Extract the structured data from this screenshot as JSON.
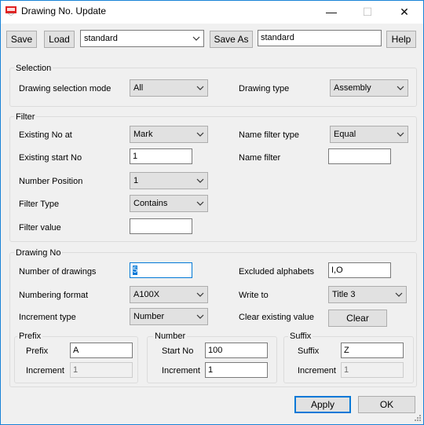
{
  "window": {
    "title": "Drawing No. Update",
    "accent_color": "#0078d7"
  },
  "title_buttons": {
    "minimize": "—",
    "maximize": "☐",
    "close": "✕"
  },
  "toolbar": {
    "save_label": "Save",
    "load_label": "Load",
    "load_value": "standard",
    "save_as_label": "Save As",
    "save_as_value": "standard",
    "help_label": "Help"
  },
  "selection": {
    "title": "Selection",
    "mode_label": "Drawing selection mode",
    "mode_value": "All",
    "type_label": "Drawing type",
    "type_value": "Assembly"
  },
  "filter": {
    "title": "Filter",
    "existing_no_at_label": "Existing No at",
    "existing_no_at_value": "Mark",
    "name_filter_type_label": "Name filter type",
    "name_filter_type_value": "Equal",
    "existing_start_label": "Existing start No",
    "existing_start_value": "1",
    "name_filter_label": "Name filter",
    "name_filter_value": "",
    "number_position_label": "Number Position",
    "number_position_value": "1",
    "filter_type_label": "Filter Type",
    "filter_type_value": "Contains",
    "filter_value_label": "Filter value",
    "filter_value_value": ""
  },
  "drawing_no": {
    "title": "Drawing No",
    "num_drawings_label": "Number of drawings",
    "num_drawings_value": "5",
    "excluded_label": "Excluded alphabets",
    "excluded_value": "I,O",
    "format_label": "Numbering format",
    "format_value": "A100X",
    "write_to_label": "Write to",
    "write_to_value": "Title 3",
    "increment_type_label": "Increment type",
    "increment_type_value": "Number",
    "clear_existing_label": "Clear existing value",
    "clear_button": "Clear",
    "prefix": {
      "title": "Prefix",
      "prefix_label": "Prefix",
      "prefix_value": "A",
      "increment_label": "Increment",
      "increment_value": "1"
    },
    "number": {
      "title": "Number",
      "start_label": "Start No",
      "start_value": "100",
      "increment_label": "Increment",
      "increment_value": "1"
    },
    "suffix": {
      "title": "Suffix",
      "suffix_label": "Suffix",
      "suffix_value": "Z",
      "increment_label": "Increment",
      "increment_value": "1"
    }
  },
  "footer": {
    "apply_label": "Apply",
    "ok_label": "OK"
  }
}
